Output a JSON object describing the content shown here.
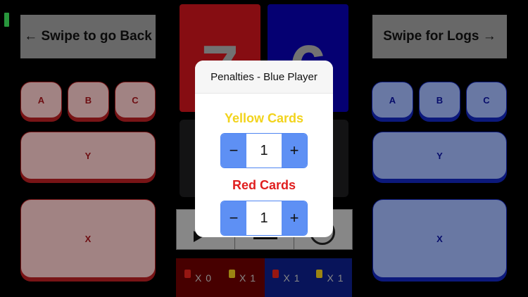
{
  "nav": {
    "back_label": "← Swipe to go Back",
    "logs_label": "Swipe for Logs →"
  },
  "scores": {
    "red": "7",
    "blue": "6"
  },
  "red_buttons": {
    "a": "A",
    "b": "B",
    "c": "C",
    "y": "Y",
    "x": "X"
  },
  "blue_buttons": {
    "a": "A",
    "b": "B",
    "c": "C",
    "y": "Y",
    "x": "X"
  },
  "tally": {
    "red_red_cards": "X 0",
    "red_yellow_cards": "X 1",
    "blue_red_cards": "X 1",
    "blue_yellow_cards": "X 1"
  },
  "modal": {
    "title": "Penalties - Blue Player",
    "yellow_label": "Yellow Cards",
    "yellow_value": "1",
    "red_label": "Red Cards",
    "red_value": "1",
    "minus": "−",
    "plus": "+"
  },
  "colors": {
    "red_accent": "#c8141b",
    "blue_accent": "#0800ab",
    "stepper_blue": "#5e90f4",
    "yellow_card": "#f2d31c",
    "red_card": "#e01e1e"
  }
}
